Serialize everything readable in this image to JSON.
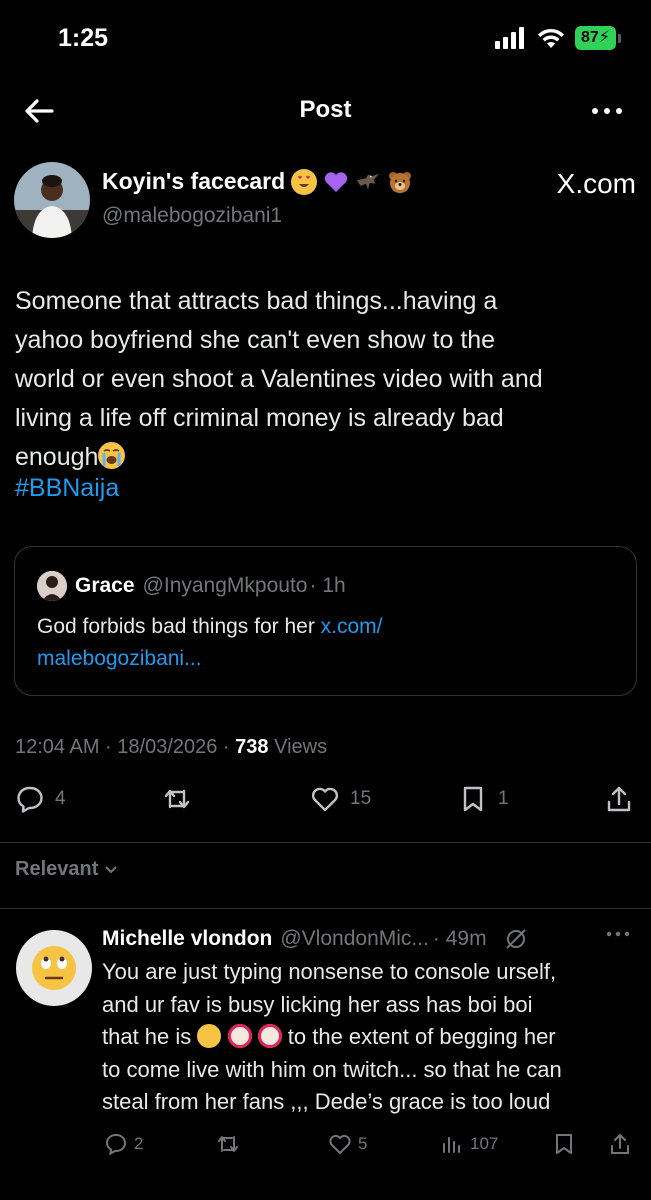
{
  "status_bar": {
    "time": "1:25",
    "battery": "87"
  },
  "nav": {
    "title": "Post"
  },
  "post": {
    "author_name": "Koyin's facecard",
    "author_handle": "@malebogozibani1",
    "source": "X.com",
    "text_lines": [
      "Someone that attracts bad things...having a",
      "yahoo boyfriend she can't even show to the",
      "world or even shoot a Valentines video with and",
      "living a life off criminal money is already bad",
      "enough"
    ],
    "hashtag": "#BBNaija",
    "quote": {
      "name": "Grace",
      "handle": "@InyangMkpouto",
      "time": "· 1h",
      "text": "God forbids bad things for her ",
      "link_line1": "x.com/",
      "link_line2": "malebogozibani..."
    },
    "meta_time": "12:04 AM · 18/03/2026 · ",
    "views_count": "738",
    "views_label": " Views",
    "replies": "4",
    "likes": "15",
    "bookmarks": "1"
  },
  "filter_label": "Relevant",
  "reply": {
    "name": "Michelle vlondon",
    "handle": "@VlondonMic...",
    "time": "· 49m",
    "line1": "You are just typing nonsense to console urself,",
    "line2": "and ur fav is busy licking her ass has boi boi",
    "line3a": "that he is ",
    "line3b": " to the extent of begging her",
    "line4": "to come live with him on twitch... so that he can",
    "line5": "steal from her fans ,,, Dede’s grace is too loud",
    "replies": "2",
    "likes": "5",
    "views": "107"
  },
  "colors": {
    "accent": "#1d9bf0",
    "muted": "#71767b",
    "battery": "#30d158"
  }
}
